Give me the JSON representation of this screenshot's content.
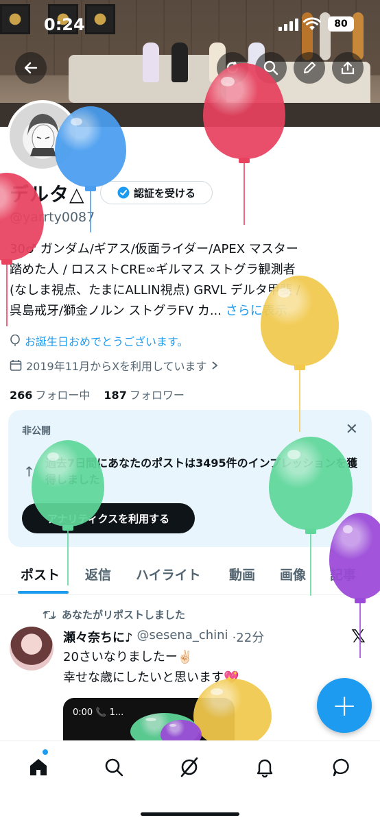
{
  "status_bar": {
    "time": "0:24",
    "battery": "80"
  },
  "profile": {
    "name": "デルタ△",
    "verify_label": "認証を受ける",
    "handle": "@yarrty0087",
    "bio_line1": "30♂ ガンダム/ギアス/仮面ライダー/APEX マスター",
    "bio_line2": "踏めた人 / ロスストCRE∞ギルマス ストグラ観測者",
    "bio_line3": "(なしま視点、たまにALLIN視点) GRVL デルタ甲斐 /",
    "bio_line4": "呉島戒牙/獅金ノルン ストグラFV カ...",
    "bio_more": "さらに表示",
    "birthday": "お誕生日おめでとうございます。",
    "joined": "2019年11月からXを利用しています",
    "following_count": "266",
    "following_label": "フォロー中",
    "followers_count": "187",
    "followers_label": "フォロワー"
  },
  "analytics_card": {
    "label": "非公開",
    "message": "過去7日間にあなたのポストは3495件のインプレッションを獲得しました",
    "button": "アナリティクスを利用する"
  },
  "tabs": [
    {
      "label": "ポスト",
      "active": true
    },
    {
      "label": "返信"
    },
    {
      "label": "ハイライト"
    },
    {
      "label": "動画"
    },
    {
      "label": "画像"
    },
    {
      "label": "記事"
    }
  ],
  "post": {
    "repost_label": "あなたがリポストしました",
    "author_name": "瀬々奈ちに♪",
    "author_handle": "@sesena_chini",
    "time": "·22分",
    "text_line1": "20さいなりましたー✌🏻",
    "text_line2": "幸せな歳にしたいと思います💖",
    "media_call": "0:00  📞 1..."
  },
  "fab_label": "+",
  "colors": {
    "accent": "#1d9bf0",
    "balloon_red": "#e8425f",
    "balloon_blue": "#4a9ef0",
    "balloon_yellow": "#f2c94c",
    "balloon_green": "#5fd79a",
    "balloon_purple": "#9b49d8"
  },
  "icons": [
    "back-arrow-icon",
    "refresh-icon",
    "search-icon",
    "edit-icon",
    "share-icon",
    "verified-icon",
    "balloon-icon",
    "calendar-icon",
    "chevron-right-icon",
    "close-icon",
    "trend-up-icon",
    "repost-icon",
    "x-logo-icon",
    "home-icon",
    "search-icon",
    "grok-icon",
    "bell-icon",
    "messages-icon"
  ]
}
